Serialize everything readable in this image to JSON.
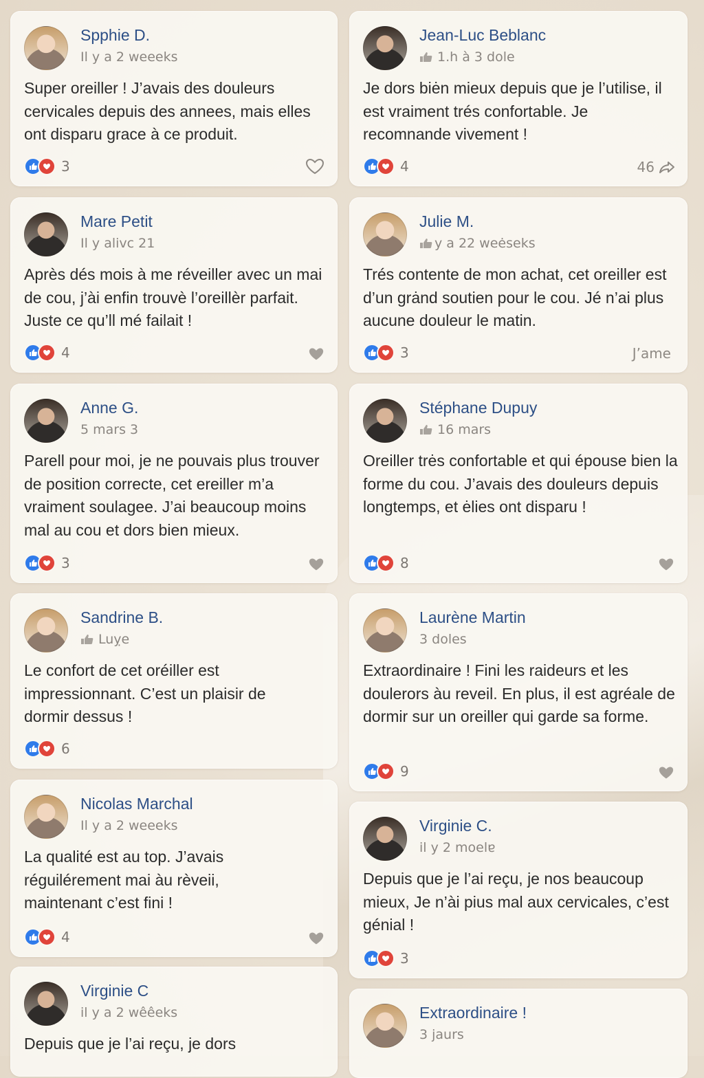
{
  "reviews_left": [
    {
      "name": "Spphie D.",
      "meta": "Il y a 2 weeeks",
      "text": "Super oreiller ! J’avais des douleurs cervicales depuis des annees, mais elles ont disparu grace à ce produit.",
      "count": "3",
      "action": "heart-outline-icon",
      "meta_icon": false,
      "avatar": "light"
    },
    {
      "name": "Mare Petit",
      "meta": "Il y alivc 21",
      "text": "Après dés mois à me réveiller avec un mai de cou, j’ài enfin trouvè l’oreillèr parfait. Juste ce qu’ll mé failait !",
      "count": "4",
      "action": "heart-icon",
      "meta_icon": false,
      "avatar": "dark"
    },
    {
      "name": "Anne G.",
      "meta": "5 mars 3",
      "text": "Parell pour moi, je ne pouvais plus trouver de position correcte, cet ereiller m’a vraiment soulagee. J’ai beaucoup moins mal au cou et dors bien mieux.",
      "count": "3",
      "action": "heart-icon",
      "meta_icon": false,
      "avatar": "dark"
    },
    {
      "name": "Sandrine B.",
      "meta": "Luỵe",
      "text": "Le confort de cet oréiller est impressionnant. C’est un plaisir de dormir dessus !",
      "count": "6",
      "action": "",
      "meta_icon": true,
      "avatar": "light"
    },
    {
      "name": "Nicolas Marchal",
      "meta": "Il y a 2 weeeks",
      "text": "La qualité est au top. J’avais réguilérement mai àu rèveii, maintenant c’est fini !",
      "count": "4",
      "action": "heart-icon",
      "meta_icon": false,
      "avatar": "light"
    },
    {
      "name": "Virginie C",
      "meta": "il y a 2 wêêeks",
      "text": "Depuis que je l’ai reçu, je dors",
      "count": "",
      "action": "",
      "meta_icon": false,
      "avatar": "dark"
    }
  ],
  "reviews_right": [
    {
      "name": "Jean-Luc Beblanc",
      "meta": "1.h à 3 dole",
      "text": "Je dors biėn mieux depuis que je l’utilise, il est vraiment trés confortable. Je recomnande vivement !",
      "count": "4",
      "action_text": "46",
      "action": "share-icon",
      "meta_icon": true,
      "avatar": "dark"
    },
    {
      "name": "Julie M.",
      "meta": "y a 22 weėseks",
      "text": "Trés contente de mon achat, cet oreiller est d’un grȧnd soutien pour le cou. Jé n’ai plus aucune douleur le matin.",
      "count": "3",
      "action_text": "J’ame",
      "action": "",
      "meta_icon": true,
      "avatar": "light"
    },
    {
      "name": "Stéphane Dupuy",
      "meta": "16 mars",
      "text": "Oreiller trės confortable et qui épouse bien la forme du cou. J’avais des douleurs depuis longtemps, et   ėlies ont disparu !",
      "count": "8",
      "action_text": "",
      "action": "heart-icon",
      "meta_icon": true,
      "avatar": "dark"
    },
    {
      "name": "Laurène Martin",
      "meta": "3 doles",
      "text": "Extraordinaire ! Fini les raideurs et les doulerors àu reveil. En plus, il est agréale de dormir sur un oreiller qui garde sa forme.",
      "count": "9",
      "action_text": "",
      "action": "heart-icon",
      "meta_icon": false,
      "avatar": "light"
    },
    {
      "name": "Virginie C.",
      "meta": "il y 2 moelɐ",
      "text": "Depuis que je l’ai reçu, je nos beaucoup mieux, Je n’ài pius mal aux cervicales, c’est génial !",
      "count": "3",
      "action_text": "",
      "action": "",
      "meta_icon": false,
      "avatar": "dark"
    },
    {
      "name": "Extraordinaire !",
      "meta": "3 jaurs",
      "text": "",
      "count": "",
      "action_text": "",
      "action": "",
      "meta_icon": false,
      "avatar": "light"
    }
  ]
}
